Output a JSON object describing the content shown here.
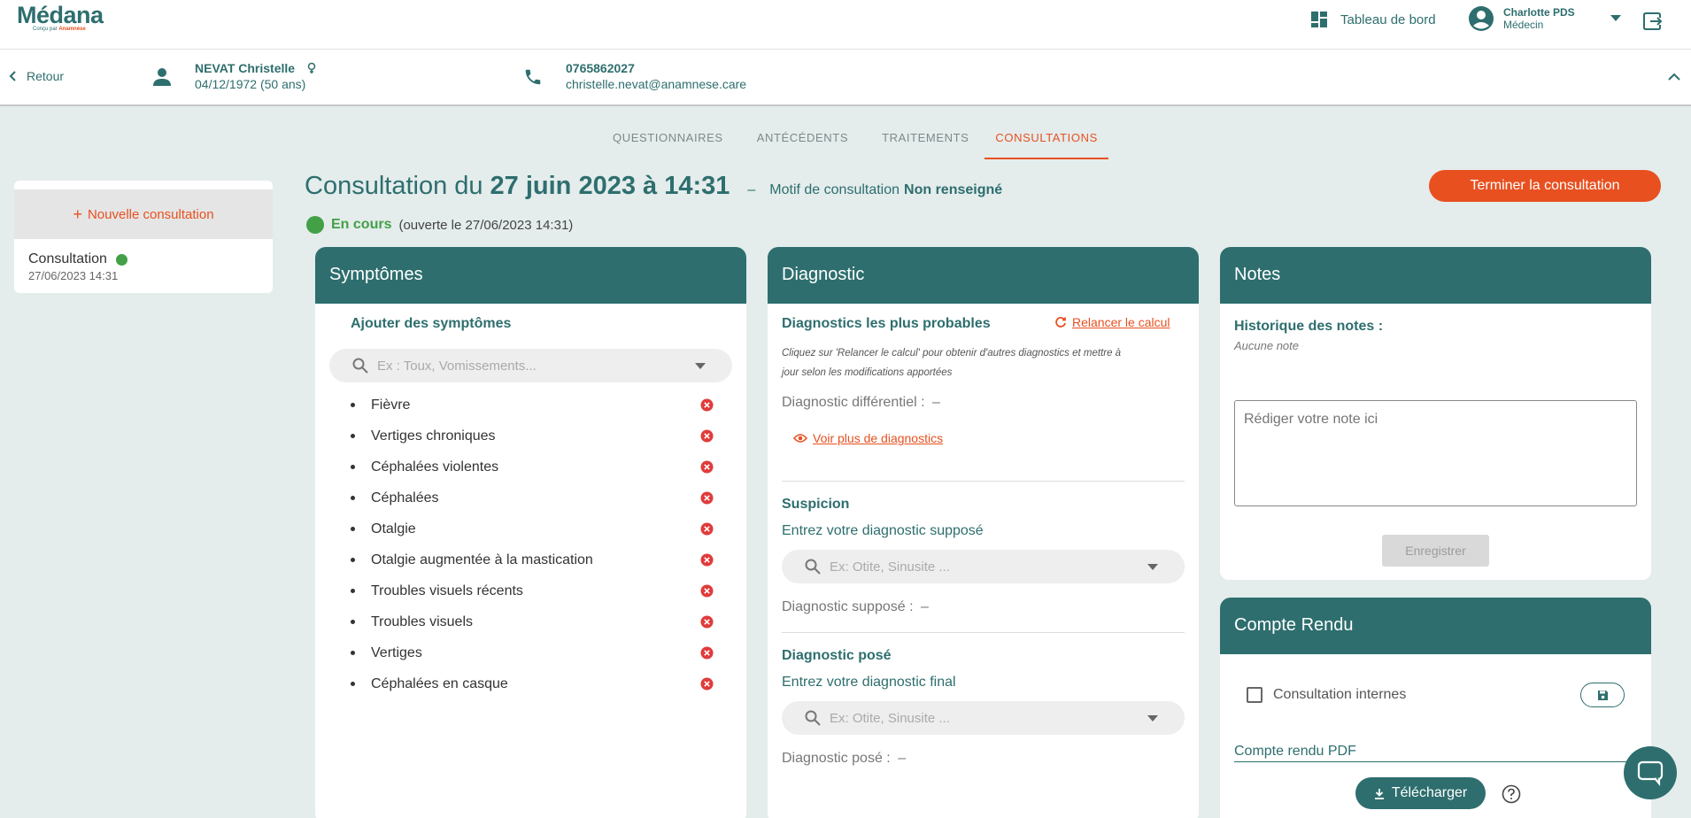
{
  "header": {
    "logo_text": "Médana",
    "logo_sub_prefix": "Conçu par ",
    "logo_sub_brand": "Anamnèse",
    "dashboard_label": "Tableau de bord",
    "user_name": "Charlotte PDS",
    "user_role": "Médecin"
  },
  "patient": {
    "back_label": "Retour",
    "name": "NEVAT Christelle",
    "dob": "04/12/1972 (50 ans)",
    "phone": "0765862027",
    "email": "christelle.nevat@anamnese.care"
  },
  "tabs": [
    {
      "label": "QUESTIONNAIRES"
    },
    {
      "label": "ANTÉCÉDENTS"
    },
    {
      "label": "TRAITEMENTS"
    },
    {
      "label": "CONSULTATIONS"
    }
  ],
  "sidebar": {
    "new_label": "Nouvelle consultation",
    "items": [
      {
        "title": "Consultation",
        "date": "27/06/2023 14:31"
      }
    ]
  },
  "consultation": {
    "title_prefix": "Consultation du",
    "title_date": "27 juin 2023 à 14:31",
    "separator": "–",
    "motif_label": "Motif de consultation",
    "motif_value": "Non renseigné",
    "status": "En cours",
    "opened": "(ouverte le 27/06/2023 14:31)",
    "finish_label": "Terminer la consultation"
  },
  "symptoms": {
    "header": "Symptômes",
    "add_label": "Ajouter des symptômes",
    "placeholder": "Ex : Toux, Vomissements...",
    "items": [
      "Fièvre",
      "Vertiges chroniques",
      "Céphalées violentes",
      "Céphalées",
      "Otalgie",
      "Otalgie augmentée à la mastication",
      "Troubles visuels récents",
      "Troubles visuels",
      "Vertiges",
      "Céphalées en casque"
    ]
  },
  "diagnostic": {
    "header": "Diagnostic",
    "probable_title": "Diagnostics les plus probables",
    "relaunch_label": "Relancer le calcul",
    "help_line1": "Cliquez sur 'Relancer le calcul' pour obtenir d'autres diagnostics et mettre à",
    "help_line2": "jour selon les modifications apportées",
    "differential_label": "Diagnostic différentiel :",
    "differential_value": "–",
    "see_more_label": "Voir plus de diagnostics",
    "suspicion_title": "Suspicion",
    "suspicion_prompt": "Entrez votre diagnostic supposé",
    "suspicion_placeholder": "Ex: Otite, Sinusite ...",
    "supposed_label": "Diagnostic supposé :",
    "supposed_value": "–",
    "final_title": "Diagnostic posé",
    "final_prompt": "Entrez votre diagnostic final",
    "final_placeholder": "Ex: Otite, Sinusite ...",
    "final_label": "Diagnostic posé :",
    "final_value": "–"
  },
  "notes": {
    "header": "Notes",
    "history_label": "Historique des notes :",
    "history_empty": "Aucune note",
    "placeholder": "Rédiger votre note ici",
    "save_label": "Enregistrer"
  },
  "report": {
    "header": "Compte Rendu",
    "internal_label": "Consultation internes",
    "pdf_label": "Compte rendu PDF",
    "download_label": "Télécharger"
  },
  "colors": {
    "primary": "#2e6e6e",
    "accent": "#e85020",
    "status_green": "#43a047",
    "background": "#e4ecec"
  }
}
